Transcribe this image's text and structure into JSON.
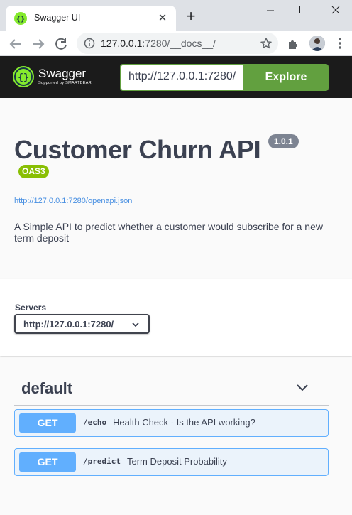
{
  "browser": {
    "tab_title": "Swagger UI",
    "url_host": "127.0.0.1",
    "url_rest": ":7280/__docs__/"
  },
  "topbar": {
    "logo_text": "Swagger",
    "logo_sub": "Supported by SMARTBEAR",
    "spec_url_input": "http://127.0.0.1:7280/",
    "explore_label": "Explore"
  },
  "info": {
    "title": "Customer Churn API",
    "version": "1.0.1",
    "oas": "OAS3",
    "spec_link": "http://127.0.0.1:7280/openapi.json",
    "description": "A Simple API to predict whether a customer would subscribe for a new term deposit"
  },
  "servers": {
    "label": "Servers",
    "selected": "http://127.0.0.1:7280/"
  },
  "tag": {
    "name": "default"
  },
  "operations": [
    {
      "method": "GET",
      "path": "/echo",
      "summary": "Health Check - Is the API working?"
    },
    {
      "method": "GET",
      "path": "/predict",
      "summary": "Term Deposit Probability"
    }
  ],
  "colors": {
    "get_method": "#61affe",
    "explore": "#62a03f",
    "oas_badge": "#89bf04",
    "topbar": "#1b1b1b"
  }
}
